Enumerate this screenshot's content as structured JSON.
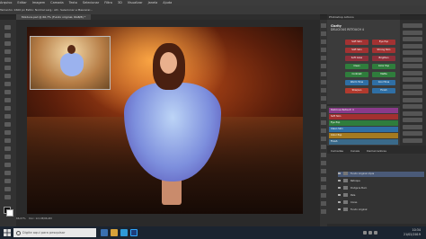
{
  "menu": [
    "Arquivo",
    "Editar",
    "Imagem",
    "Camada",
    "Texto",
    "Selecionar",
    "Filtro",
    "3D",
    "Visualizar",
    "Janela",
    "Ajuda"
  ],
  "options_bar": {
    "text": "Tamanho: 1600 px   Estilo: Normal   Larg.:   Alt.:   Selecionar e Mascarar..."
  },
  "document_tab": {
    "label": "Moldura.psd @ 66,7% (Fundo original, RGB/8) *"
  },
  "actions_panel": {
    "title": "Photoshop Actions",
    "logo_line1": "Clarity",
    "logo_line2": "DELICIOUS RETOUCH 4",
    "buttons": [
      {
        "label": "Soft Skin",
        "color": "#a23232"
      },
      {
        "label": "Eye Pop",
        "color": "#a23232"
      },
      {
        "label": "Soft Skin",
        "color": "#a23232"
      },
      {
        "label": "Strong Skin",
        "color": "#a23232"
      },
      {
        "label": "Soft Glow",
        "color": "#8e2f3a"
      },
      {
        "label": "Brighten",
        "color": "#8e2f3a"
      },
      {
        "label": "Clean",
        "color": "#2f7d3c"
      },
      {
        "label": "Color Pop",
        "color": "#2f7d3c"
      },
      {
        "label": "Contrast",
        "color": "#2f7d3c"
      },
      {
        "label": "Matte",
        "color": "#2f7d3c"
      },
      {
        "label": "Warm Tone",
        "color": "#2f6fa5"
      },
      {
        "label": "Cool Tone",
        "color": "#2f6fa5"
      },
      {
        "label": "Sharpen",
        "color": "#b13a2e"
      },
      {
        "label": "Finish",
        "color": "#2f6fa5"
      }
    ]
  },
  "properties_panel": {
    "rows": [
      {
        "label": "Delicious Retouch 4",
        "color": "#8a3a8a"
      },
      {
        "label": "Soft Skin",
        "color": "#a33030"
      },
      {
        "label": "Eye Pop",
        "color": "#2f7d3c"
      },
      {
        "label": "Clean Skin",
        "color": "#2f6fa5"
      },
      {
        "label": "Color Pop",
        "color": "#a57a20"
      },
      {
        "label": "Finish",
        "color": "#3a6a8a"
      }
    ]
  },
  "layers_panel": {
    "tabs": [
      "Camadas",
      "Canais",
      "Demarcadores"
    ],
    "layers": [
      {
        "name": "Fundo original cópia",
        "selected": true
      },
      {
        "name": "Retoque",
        "selected": false
      },
      {
        "name": "Dodge & Burn",
        "selected": false
      },
      {
        "name": "Pele",
        "selected": false
      },
      {
        "name": "Cores",
        "selected": false
      },
      {
        "name": "Fundo original",
        "selected": false
      }
    ]
  },
  "status_bar": {
    "zoom": "66,67%",
    "doc_info": "Doc: 12,1M/96,4M"
  },
  "taskbar": {
    "search_placeholder": "Digite aqui para pesquisar",
    "time": "10:34",
    "date": "21/02/2019"
  }
}
